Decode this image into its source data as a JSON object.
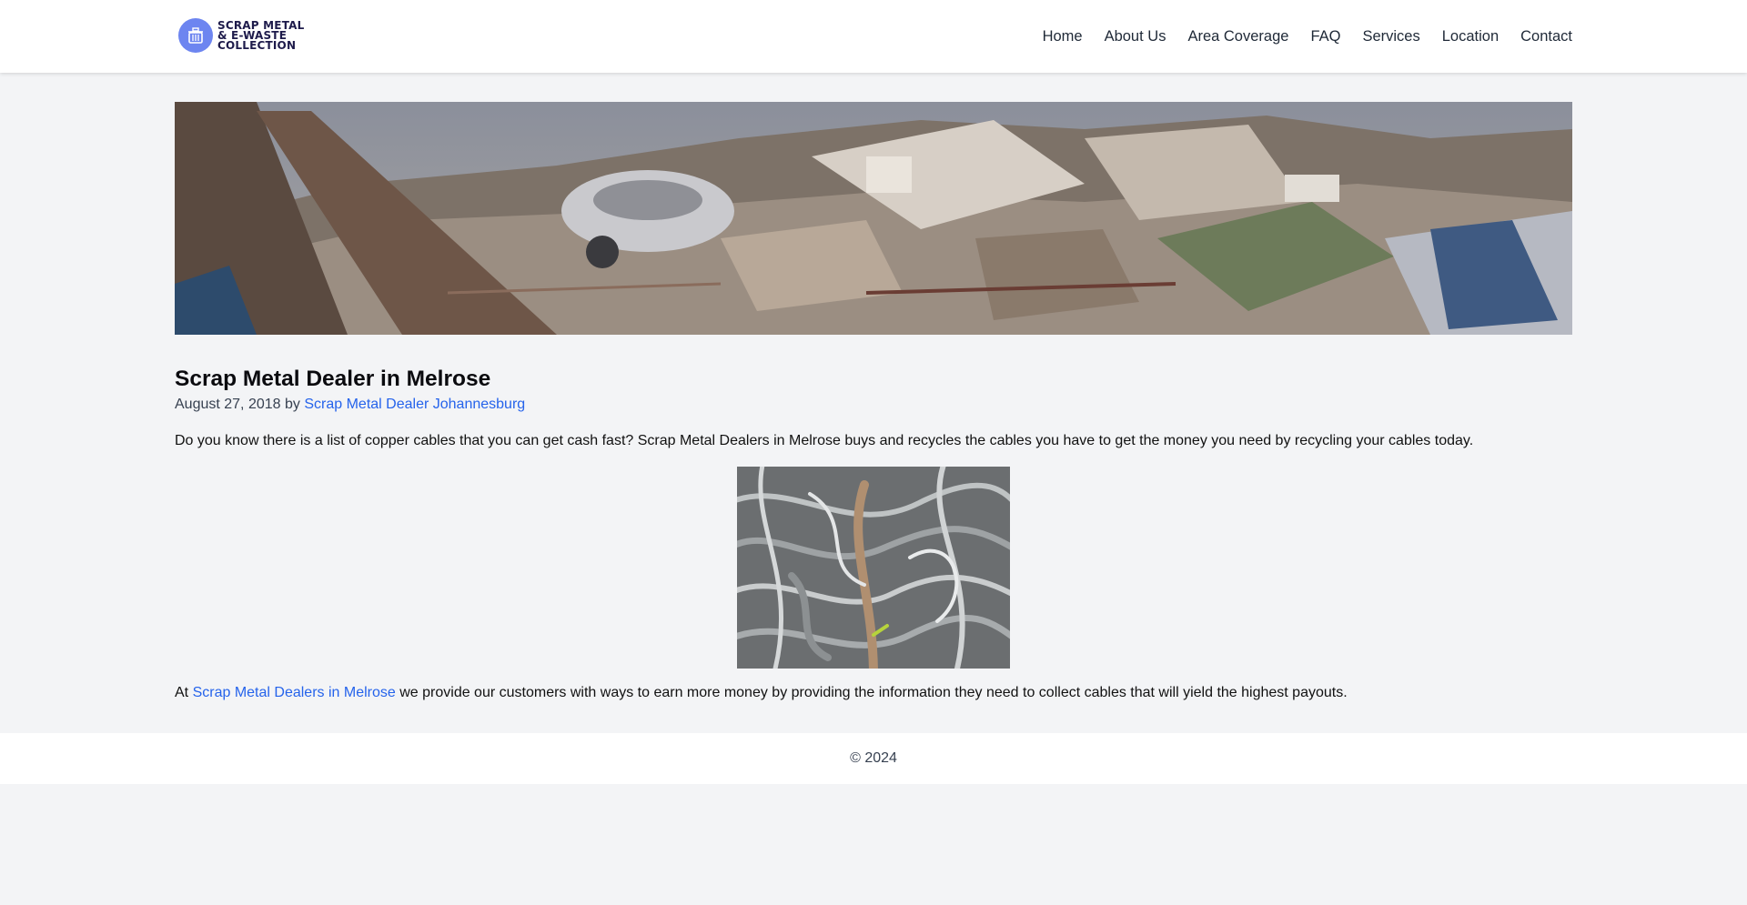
{
  "brand": {
    "logo_lines": [
      "SCRAP METAL",
      "& E-WASTE",
      "COLLECTION"
    ],
    "logo_icon": "recycle-bin-icon",
    "accent_color": "#6d85f0"
  },
  "nav": {
    "items": [
      {
        "label": "Home"
      },
      {
        "label": "About Us"
      },
      {
        "label": "Area Coverage"
      },
      {
        "label": "FAQ"
      },
      {
        "label": "Services"
      },
      {
        "label": "Location"
      },
      {
        "label": "Contact"
      }
    ]
  },
  "post": {
    "title": "Scrap Metal Dealer in Melrose",
    "date": "August 27, 2018",
    "by": "by",
    "author": "Scrap Metal Dealer Johannesburg",
    "paragraph1": "Do you know there is a list of copper cables that you can get cash fast? Scrap Metal Dealers in Melrose buys and recycles the cables you have to get the money you need by recycling your cables today.",
    "paragraph2_prefix": "At",
    "paragraph2_link": "Scrap Metal Dealers in Melrose",
    "paragraph2_suffix": "we provide our customers with ways to earn more money by providing the information they need to collect cables that will yield the highest payouts.",
    "link_color": "#2563eb"
  },
  "footer": {
    "copyright": "© 2024"
  }
}
